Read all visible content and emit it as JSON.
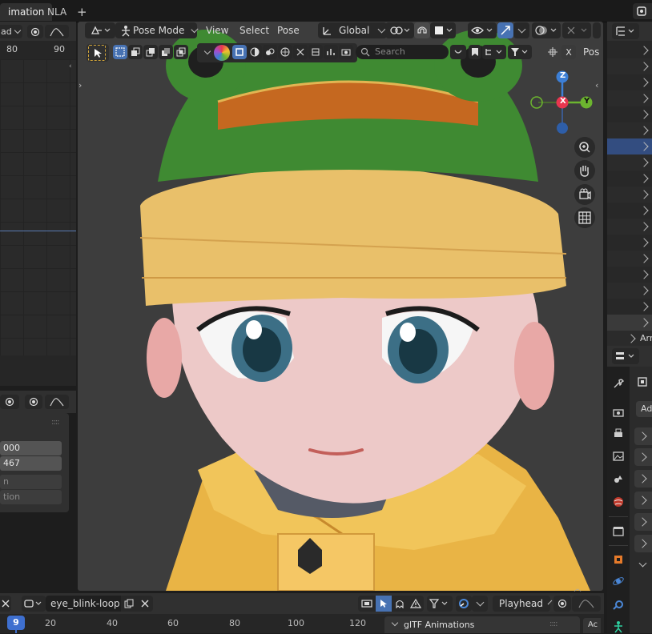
{
  "top_tabs": {
    "animation": "imation",
    "nla": "NLA",
    "add": "+"
  },
  "left_editor": {
    "header_partial": "ad",
    "ruler": [
      "80",
      "90"
    ],
    "fields": [
      {
        "value": "000",
        "dim": false
      },
      {
        "value": "467",
        "dim": false
      },
      {
        "value": "n",
        "dim": true
      },
      {
        "value": "tion",
        "dim": true
      }
    ]
  },
  "viewport_header": {
    "mode": "Pose Mode",
    "menus": [
      "View",
      "Select",
      "Pose"
    ],
    "orientation": "Global",
    "search_placeholder": "Search",
    "pos_partial": "Pos",
    "x_label": "X"
  },
  "gizmo": {
    "z": "Z",
    "x": "X",
    "y": "Y"
  },
  "outliner": {
    "arm_partial": "Arr"
  },
  "properties": {
    "ad_partial": "Ad"
  },
  "timeline": {
    "action_name": "eye_blink-loop",
    "playhead": "Playhead",
    "current_frame": "9",
    "ruler": [
      "20",
      "40",
      "60",
      "80",
      "100",
      "120"
    ],
    "gltf_panel": "glTF Animations",
    "ac_partial": "Ac"
  },
  "colors": {
    "accent_blue": "#4772b3",
    "axis_x": "#e8364f",
    "axis_y": "#6cb52f",
    "axis_z": "#3c7fd6",
    "frame_blue": "#3e6fcf"
  }
}
